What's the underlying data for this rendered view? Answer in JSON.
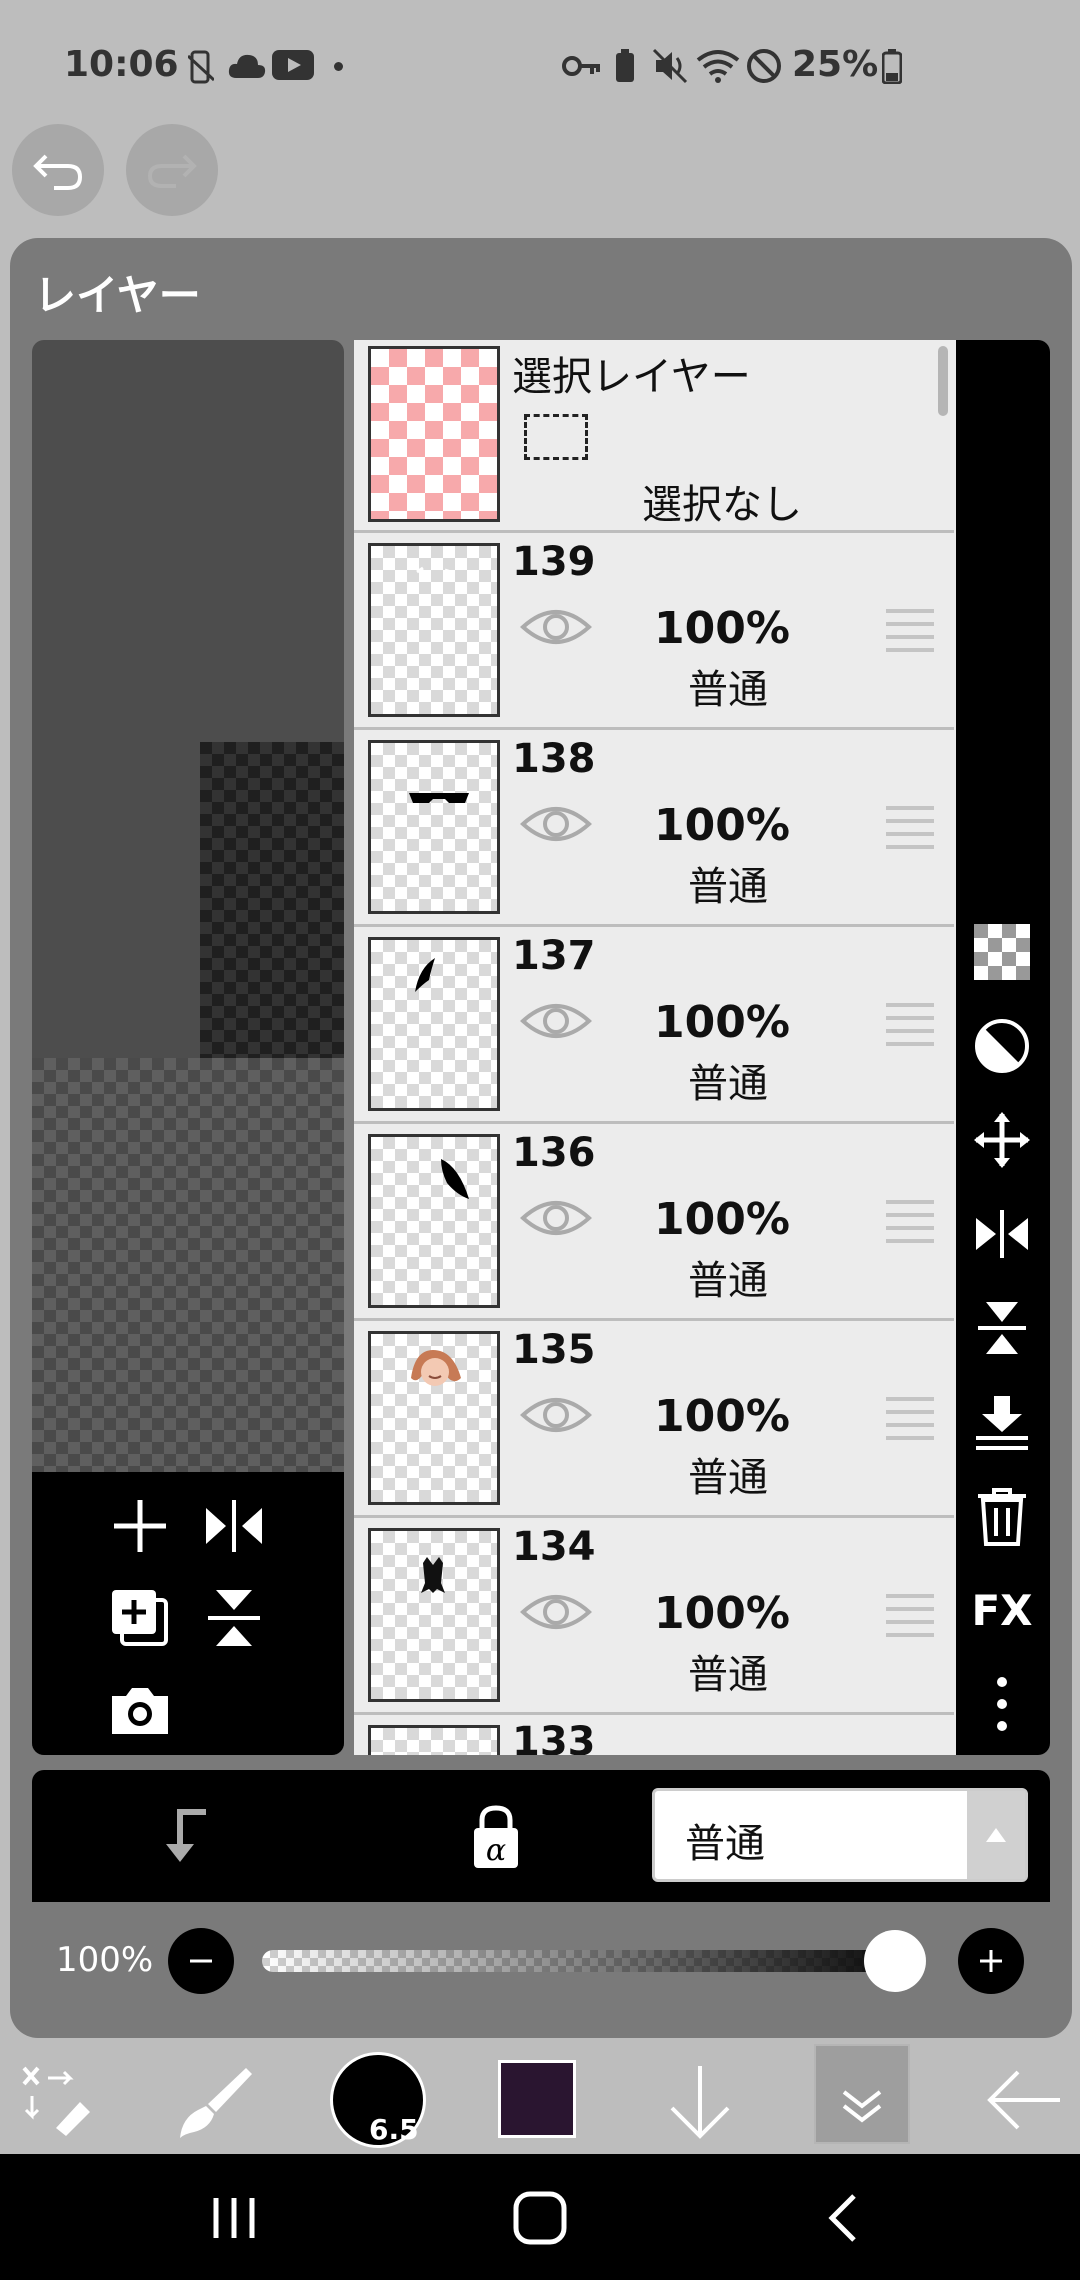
{
  "status_bar": {
    "time": "10:06",
    "battery": "25%"
  },
  "panel": {
    "title": "レイヤー"
  },
  "selection_layer": {
    "name": "選択レイヤー",
    "status": "選択なし"
  },
  "layers": [
    {
      "name": "139",
      "opacity": "100%",
      "blend": "普通"
    },
    {
      "name": "138",
      "opacity": "100%",
      "blend": "普通"
    },
    {
      "name": "137",
      "opacity": "100%",
      "blend": "普通"
    },
    {
      "name": "136",
      "opacity": "100%",
      "blend": "普通"
    },
    {
      "name": "135",
      "opacity": "100%",
      "blend": "普通"
    },
    {
      "name": "134",
      "opacity": "100%",
      "blend": "普通"
    },
    {
      "name": "133"
    }
  ],
  "side_tools": {
    "fx_label": "FX"
  },
  "blend_mode": {
    "selected": "普通"
  },
  "opacity_slider": {
    "label": "100%",
    "value": 1.0
  },
  "bottom_toolbar": {
    "brush_size": "6.5",
    "color": "#2a1530"
  }
}
